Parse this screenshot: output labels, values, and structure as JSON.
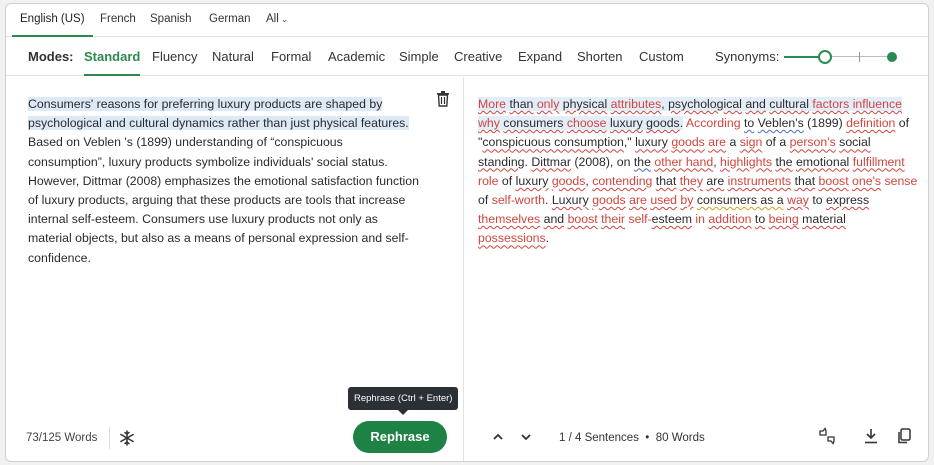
{
  "languages": {
    "tabs": [
      "English (US)",
      "French",
      "Spanish",
      "German"
    ],
    "all_label": "All",
    "active": "English (US)"
  },
  "modes": {
    "label": "Modes:",
    "items": [
      "Standard",
      "Fluency",
      "Natural",
      "Formal",
      "Academic",
      "Simple",
      "Creative",
      "Expand",
      "Shorten",
      "Custom"
    ],
    "active": "Standard",
    "synonyms_label": "Synonyms:"
  },
  "input": {
    "highlighted": "Consumers' reasons for preferring luxury products are shaped by psychological and cultural dynamics rather than just physical features.",
    "rest": " Based on Veblen 's (1899) understanding of “conspicuous consumption”, luxury products symbolize individuals' social status. However, Dittmar (2008) emphasizes the emotional satisfaction function of luxury products, arguing that these products are tools that increase internal self-esteem. Consumers use luxury products not only as material objects, but also as a means of personal expression and self-confidence.",
    "word_count": "73/125 Words",
    "rephrase_label": "Rephrase",
    "tooltip": "Rephrase (Ctrl + Enter)"
  },
  "output": {
    "sentences": "1 / 4 Sentences",
    "words": "80 Words"
  },
  "colors": {
    "accent": "#1e8245",
    "changed": "#d1443c",
    "highlight": "#dde9f7"
  },
  "icons": [
    "trash-icon",
    "snowflake-icon",
    "chevron-up-icon",
    "chevron-down-icon",
    "feedback-icon",
    "download-icon",
    "copy-icon"
  ]
}
